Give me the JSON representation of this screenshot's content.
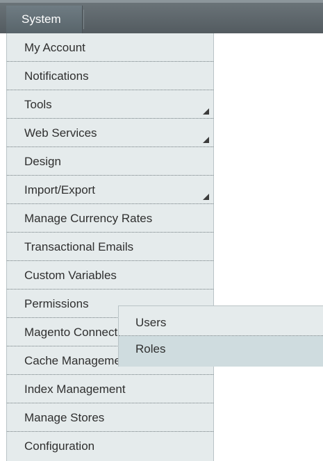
{
  "topbar": {
    "tab_label": "System"
  },
  "menu": {
    "items": [
      {
        "label": "My Account",
        "has_submenu": false
      },
      {
        "label": "Notifications",
        "has_submenu": false
      },
      {
        "label": "Tools",
        "has_submenu": true
      },
      {
        "label": "Web Services",
        "has_submenu": true
      },
      {
        "label": "Design",
        "has_submenu": false
      },
      {
        "label": "Import/Export",
        "has_submenu": true
      },
      {
        "label": "Manage Currency Rates",
        "has_submenu": false
      },
      {
        "label": "Transactional Emails",
        "has_submenu": false
      },
      {
        "label": "Custom Variables",
        "has_submenu": false
      },
      {
        "label": "Permissions",
        "has_submenu": false
      },
      {
        "label": "Magento Connect",
        "has_submenu": false
      },
      {
        "label": "Cache Management",
        "has_submenu": false
      },
      {
        "label": "Index Management",
        "has_submenu": false
      },
      {
        "label": "Manage Stores",
        "has_submenu": false
      },
      {
        "label": "Configuration",
        "has_submenu": false
      }
    ]
  },
  "submenu": {
    "parent": "Permissions",
    "items": [
      {
        "label": "Users"
      },
      {
        "label": "Roles",
        "hovered": true
      }
    ]
  },
  "colors": {
    "topbar": "#5e676c",
    "menu_bg": "#e5ebec",
    "hover_bg": "#cfdcdf",
    "text": "#2f2f2f"
  }
}
